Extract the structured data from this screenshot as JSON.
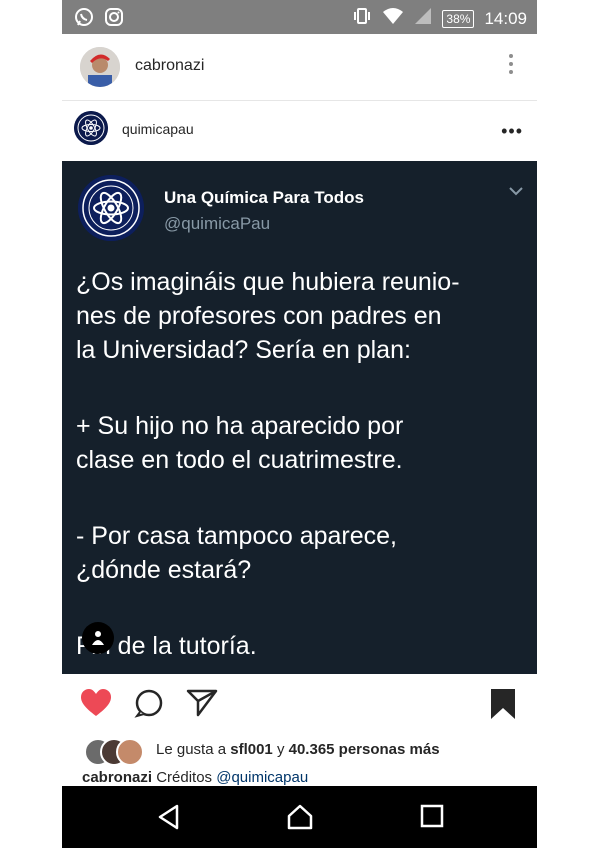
{
  "status_bar": {
    "left_icons": [
      "whatsapp-icon",
      "instagram-icon"
    ],
    "right_icons": [
      "vibrate-icon",
      "wifi-icon",
      "signal-icon"
    ],
    "battery": "38%",
    "time": "14:09"
  },
  "profile": {
    "username": "cabronazi"
  },
  "post": {
    "username": "quimicapau",
    "more": "•••",
    "tweet": {
      "name": "Una Química Para Todos",
      "handle": "@quimicaPau",
      "lines": [
        "¿Os imagináis que hubiera reunio-",
        "nes de profesores con padres en",
        "la Universidad? Sería en plan:",
        "+ Su hijo no ha aparecido por",
        "clase en todo el cuatrimestre.",
        "- Por casa tampoco aparece,",
        "¿dónde estará?",
        "Fin de la tutoría."
      ]
    },
    "likes": {
      "prefix": "Le gusta a",
      "user": "sfl001",
      "conj": "y",
      "count": "40.365 personas más"
    },
    "caption": {
      "user": "cabronazi",
      "text": "Créditos",
      "mention": "@quimicapau"
    }
  },
  "colors": {
    "like": "#ed4956",
    "tweet_bg": "#15202b",
    "handle": "#8899a6",
    "status_bar": "#7f7f7f"
  }
}
